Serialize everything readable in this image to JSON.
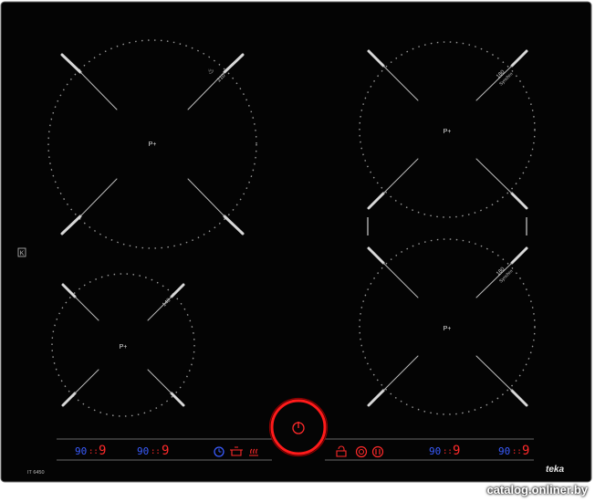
{
  "hob": {
    "model": "IT 6450",
    "brand": "teka",
    "k_mark": "K"
  },
  "zones": {
    "top_left": {
      "power_label": "P+",
      "diameter": "210"
    },
    "bottom_left": {
      "power_label": "P+",
      "diameter": "140"
    },
    "top_right": {
      "power_label": "P+",
      "diameter": "180",
      "sync_label": "Synchro"
    },
    "bottom_right": {
      "power_label": "P+",
      "diameter": "180",
      "sync_label": "Synchro"
    }
  },
  "controls": {
    "displays": [
      {
        "timer": "90",
        "level": "9"
      },
      {
        "timer": "90",
        "level": "9"
      },
      {
        "timer": "90",
        "level": "9"
      },
      {
        "timer": "90",
        "level": "9"
      }
    ],
    "power_symbol": "⏻"
  },
  "watermark": "catalog.onliner.by",
  "colors": {
    "glass": "#040404",
    "display_red": "#ff2a2a",
    "display_blue": "#3a5cff",
    "ring_red": "#ff1a1a",
    "marker": "#cfcfcf"
  }
}
